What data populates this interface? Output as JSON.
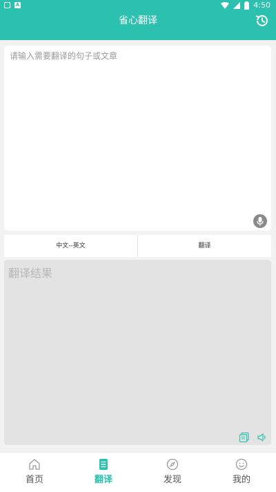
{
  "status_bar": {
    "time": "4:50"
  },
  "app_bar": {
    "title": "省心翻译"
  },
  "input": {
    "placeholder": "请输入需要翻译的句子或文章",
    "value": ""
  },
  "actions": {
    "language_pair": "中文--英文",
    "translate_label": "翻译"
  },
  "result": {
    "placeholder": "翻译结果"
  },
  "bottom_nav": {
    "items": [
      {
        "label": "首页",
        "icon": "home-icon",
        "active": false
      },
      {
        "label": "翻译",
        "icon": "translate-icon",
        "active": true
      },
      {
        "label": "发现",
        "icon": "compass-icon",
        "active": false
      },
      {
        "label": "我的",
        "icon": "profile-icon",
        "active": false
      }
    ]
  },
  "colors": {
    "primary": "#2cc1ae",
    "background": "#f2f2f2",
    "result_background": "#e3e3e3"
  }
}
